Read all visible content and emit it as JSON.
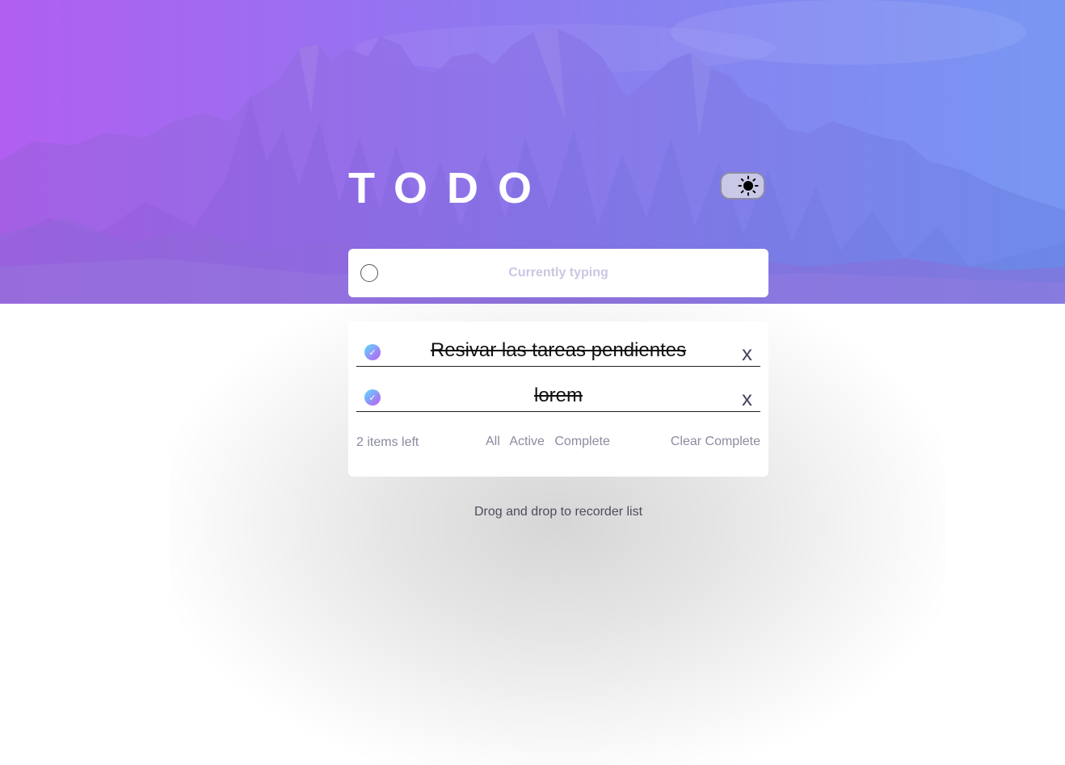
{
  "header": {
    "title": "TODO",
    "theme_toggle_icon": "sun-icon"
  },
  "new_todo": {
    "placeholder": "Currently typing",
    "value": ""
  },
  "todos": [
    {
      "text": "Resivar las tareas pendientes",
      "completed": true,
      "delete_label": "x"
    },
    {
      "text": "lorem",
      "completed": true,
      "delete_label": "x"
    }
  ],
  "footer": {
    "items_left": "2 items left",
    "filters": [
      "All",
      "Active",
      "Complete"
    ],
    "clear_label": "Clear Complete"
  },
  "hint": "Drog and drop to recorder list",
  "colors": {
    "check_gradient_start": "#57ddff",
    "check_gradient_end": "#c058f3",
    "banner_left": "#b15ff0",
    "banner_right": "#7897f2"
  }
}
